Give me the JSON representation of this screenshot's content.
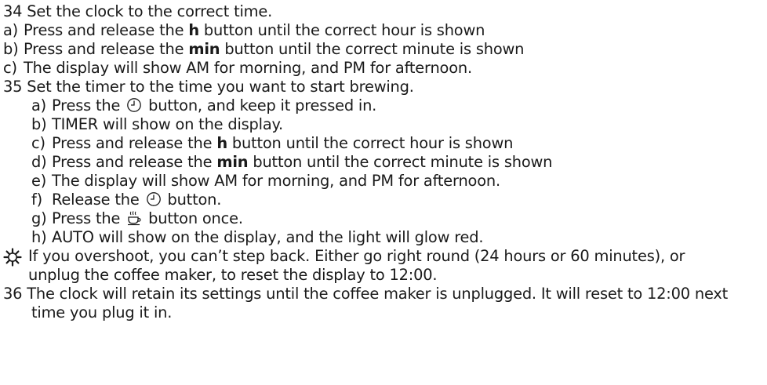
{
  "steps": [
    {
      "num": "34",
      "text": "Set the clock to the correct time."
    },
    {
      "num": "35",
      "text": "Set the timer to the time you want to start brewing."
    },
    {
      "num": "36",
      "text": "The clock will retain its settings until the coffee maker is unplugged. It will reset to 12:00 next",
      "cont": "time you plug it in."
    }
  ],
  "clock_items": [
    {
      "marker": "a)",
      "pre": "Press and release the ",
      "bold": "h",
      "post": " button until the correct hour is shown"
    },
    {
      "marker": "b)",
      "pre": "Press and release the ",
      "bold": "min",
      "post": " button until the correct minute is shown"
    },
    {
      "marker": "c)",
      "text": "The display will show AM for morning, and PM for afternoon."
    }
  ],
  "timer_items": [
    {
      "marker": "a)",
      "pre": "Press the ",
      "icon": "timer-clock-icon",
      "post": " button, and keep it pressed in."
    },
    {
      "marker": "b)",
      "text": "TIMER will show on the display."
    },
    {
      "marker": "c)",
      "pre": "Press and release the ",
      "bold": "h",
      "post": " button until the correct hour is shown"
    },
    {
      "marker": "d)",
      "pre": "Press and release the ",
      "bold": "min",
      "post": " button until the correct minute is shown"
    },
    {
      "marker": "e)",
      "text": "The display will show AM for morning, and PM for afternoon."
    },
    {
      "marker": "f)",
      "pre": "Release the ",
      "icon": "timer-clock-icon",
      "post": " button."
    },
    {
      "marker": "g)",
      "pre": "Press the ",
      "icon": "coffee-cup-icon",
      "post": " button once."
    },
    {
      "marker": "h)",
      "text": "AUTO will show on the display, and the light will glow red."
    }
  ],
  "tip": {
    "icon": "sun-tip-icon",
    "line1": "If you overshoot, you can’t step back. Either go right round (24 hours or 60 minutes), or",
    "line2": "unplug the coffee maker, to reset the display to 12:00."
  }
}
